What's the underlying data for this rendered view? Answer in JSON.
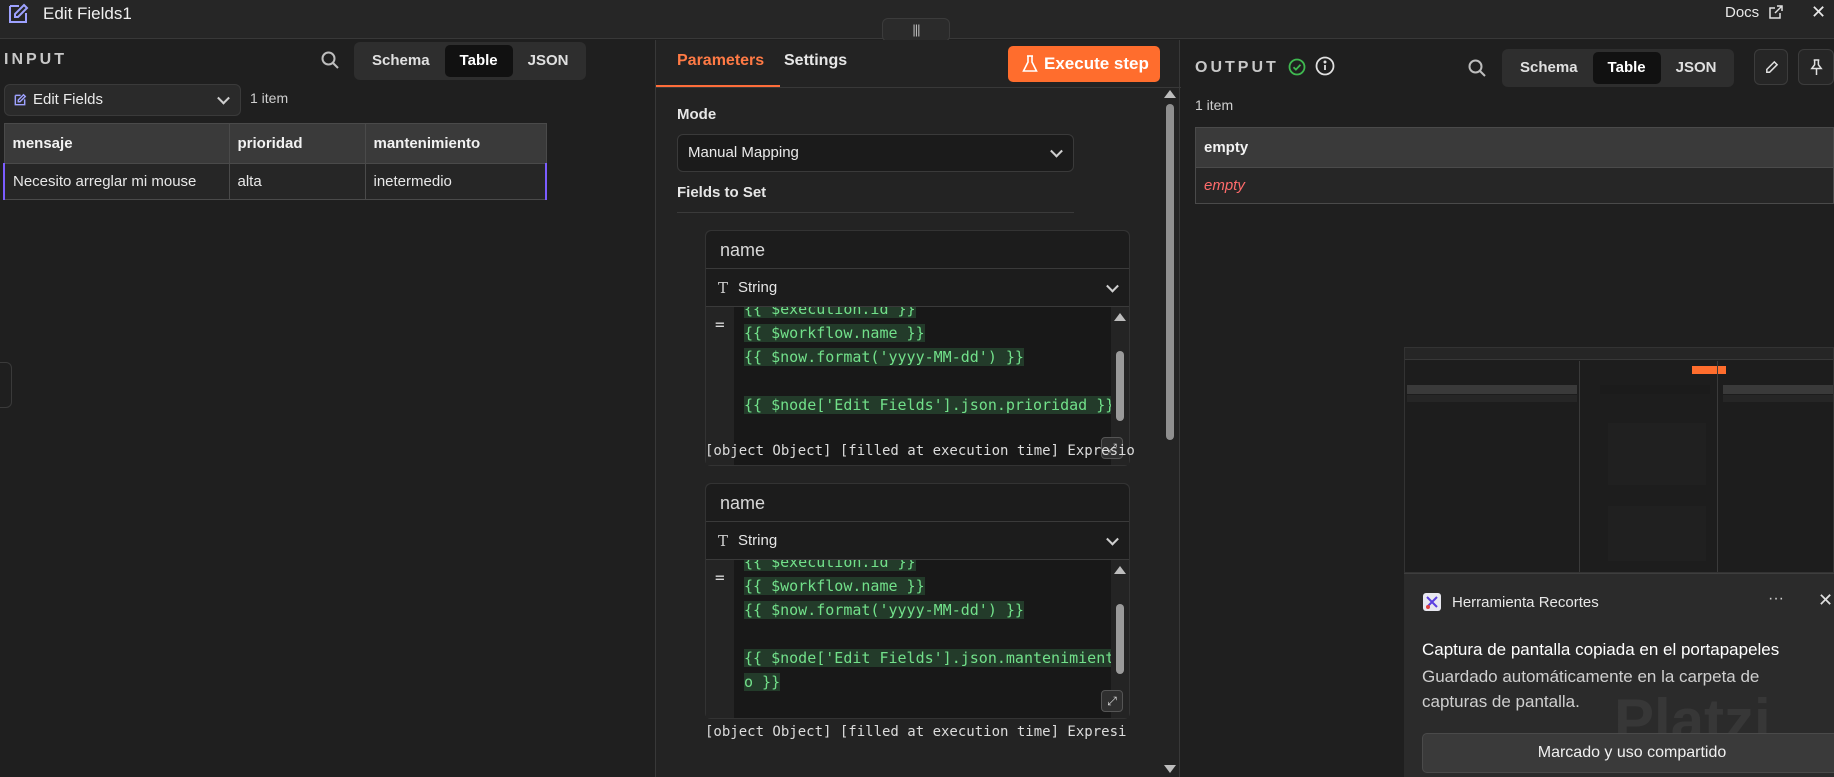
{
  "header": {
    "title": "Edit Fields1",
    "docs_label": "Docs",
    "drag_handle": "|||"
  },
  "input": {
    "section_label": "INPUT",
    "view_tabs": [
      "Schema",
      "Table",
      "JSON"
    ],
    "active_view": "Table",
    "node_select": "Edit Fields",
    "item_count": "1 item",
    "table": {
      "columns": [
        "mensaje",
        "prioridad",
        "mantenimiento"
      ],
      "rows": [
        [
          "Necesito arreglar mi mouse",
          "alta",
          "inetermedio"
        ]
      ]
    }
  },
  "parameters": {
    "tabs": [
      "Parameters",
      "Settings"
    ],
    "active_tab": "Parameters",
    "execute_label": "Execute step",
    "mode_label": "Mode",
    "mode_value": "Manual Mapping",
    "fields_label": "Fields to Set",
    "fields": [
      {
        "name": "name",
        "type": "String",
        "code": [
          "{{ $execution.id }}",
          "{{ $workflow.name }}",
          "{{ $now.format('yyyy-MM-dd') }}",
          "",
          "{{ $node['Edit Fields'].json.prioridad }}"
        ],
        "hint": "[object Object] [filled at execution time] Expresio"
      },
      {
        "name": "name",
        "type": "String",
        "code": [
          "{{ $execution.id }}",
          "{{ $workflow.name }}",
          "{{ $now.format('yyyy-MM-dd') }}",
          "",
          "{{ $node['Edit Fields'].json.mantenimient",
          "o }}"
        ],
        "hint": "[object Object]  [filled at execution time] Expresi"
      }
    ]
  },
  "output": {
    "section_label": "OUTPUT",
    "view_tabs": [
      "Schema",
      "Table",
      "JSON"
    ],
    "active_view": "Table",
    "item_count": "1 item",
    "table": {
      "columns": [
        "empty"
      ],
      "rows": [
        [
          "empty"
        ]
      ]
    }
  },
  "toast": {
    "app_name": "Herramienta Recortes",
    "more": "···",
    "title": "Captura de pantalla copiada en el portapapeles",
    "body": "Guardado automáticamente en la carpeta de capturas de pantalla.",
    "button": "Marcado y uso compartido",
    "watermark": "Platzi"
  },
  "colors": {
    "accent": "#ff6d2d",
    "code_green": "#72e08a",
    "empty_red": "#ff6b6b",
    "success_green": "#3fb950"
  }
}
